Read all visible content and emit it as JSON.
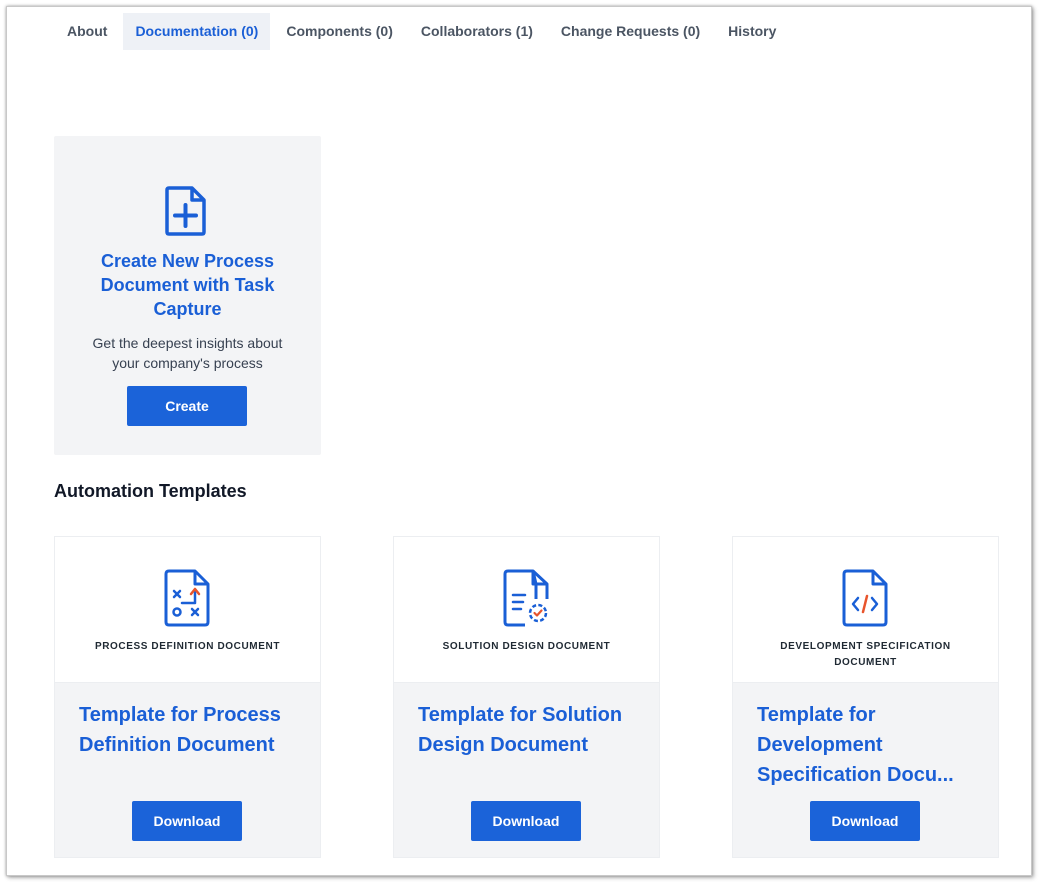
{
  "tabs": [
    {
      "label": "About"
    },
    {
      "label": "Documentation (0)"
    },
    {
      "label": "Components (0)"
    },
    {
      "label": "Collaborators (1)"
    },
    {
      "label": "Change Requests (0)"
    },
    {
      "label": "History"
    }
  ],
  "active_tab": "Documentation (0)",
  "create_card": {
    "icon": "file-plus-icon",
    "title": "Create New Process Document with Task Capture",
    "description": "Get the deepest insights about your company's process",
    "button_label": "Create"
  },
  "section_title": "Automation Templates",
  "templates": [
    {
      "icon": "process-map-document-icon",
      "label": "PROCESS DEFINITION DOCUMENT",
      "title": "Template for Process\nDefinition Document",
      "button_label": "Download"
    },
    {
      "icon": "document-gear-icon",
      "label": "SOLUTION DESIGN DOCUMENT",
      "title": "Template for Solution\nDesign Document",
      "button_label": "Download"
    },
    {
      "icon": "document-code-icon",
      "label": "DEVELOPMENT SPECIFICATION DOCUMENT",
      "title": "Template for\nDevelopment\nSpecification Docu...",
      "button_label": "Download"
    }
  ],
  "colors": {
    "accent": "#1a5fd6",
    "button": "#1b63d9",
    "icon_highlight": "#e8542c",
    "card_bg": "#f3f4f6"
  }
}
